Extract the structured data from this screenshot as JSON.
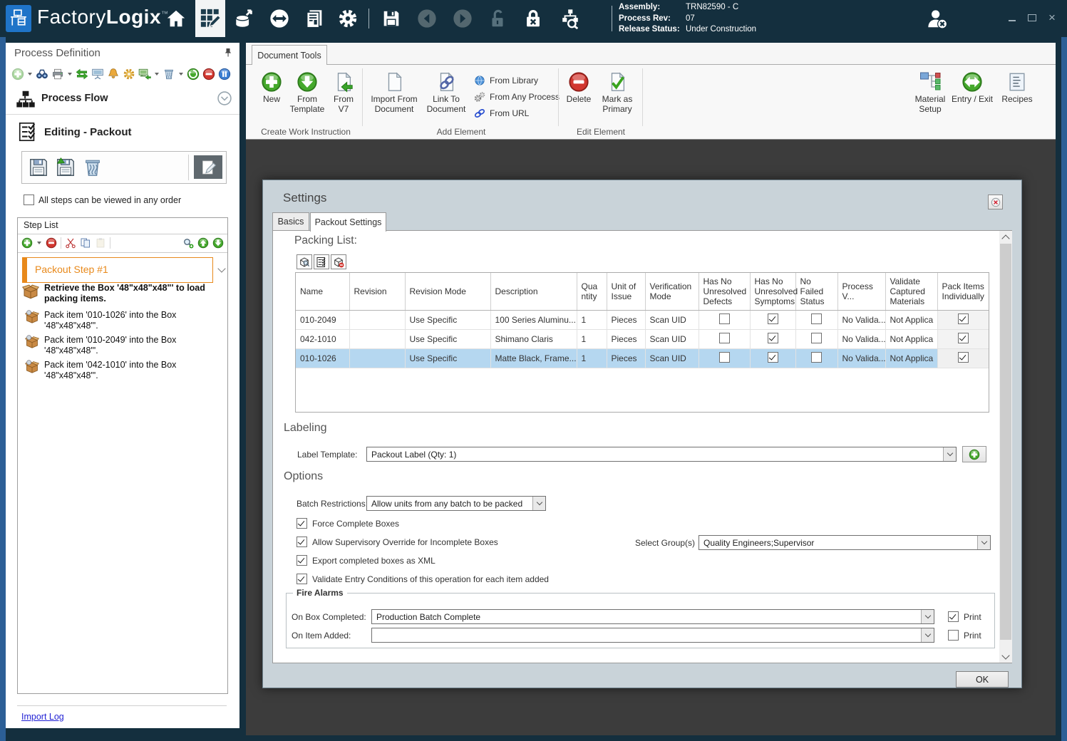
{
  "titlebar": {
    "app_name_light": "Factory",
    "app_name_bold": "Logix",
    "trademark": "™",
    "assembly": {
      "label": "Assembly:",
      "value": "TRN82590 - C"
    },
    "process_rev": {
      "label": "Process Rev:",
      "value": "07"
    },
    "release_status": {
      "label": "Release Status:",
      "value": "Under Construction"
    }
  },
  "left_panel": {
    "title": "Process Definition",
    "process_flow_label": "Process Flow",
    "editing_label": "Editing - Packout",
    "any_order": {
      "label": "All steps can be viewed in any order",
      "checked": false
    },
    "step_list": {
      "title": "Step List",
      "selected_step_label": "Packout Step #1",
      "steps": [
        {
          "text": "Retrieve the Box '48\"x48\"x48\"' to load packing items.",
          "bold": true
        },
        {
          "text": "Pack item '010-1026' into the Box '48\"x48\"x48\"'.",
          "bold": false
        },
        {
          "text": "Pack item '010-2049' into the Box '48\"x48\"x48\"'.",
          "bold": false
        },
        {
          "text": "Pack item '042-1010' into the Box '48\"x48\"x48\"'.",
          "bold": false
        }
      ]
    },
    "import_log": "Import Log"
  },
  "ribbon": {
    "tab_label": "Document Tools",
    "create_group": {
      "label": "Create Work Instruction",
      "new": "New",
      "from_template": "From Template",
      "from_v7": "From V7"
    },
    "add_group": {
      "label": "Add Element",
      "import_from_document": "Import From Document",
      "link_to_document": "Link To Document",
      "from_library": "From Library",
      "from_any_process": "From Any Process",
      "from_url": "From URL"
    },
    "edit_group": {
      "label": "Edit Element",
      "delete": "Delete",
      "mark_as_primary": "Mark as Primary"
    },
    "right_items": {
      "material_setup": "Material Setup",
      "entry_exit": "Entry / Exit",
      "recipes": "Recipes"
    }
  },
  "dialog": {
    "title": "Settings",
    "tab_basics": "Basics",
    "tab_packout": "Packout Settings",
    "packing_list": {
      "heading": "Packing List:",
      "columns": [
        "Name",
        "Revision",
        "Revision Mode",
        "Description",
        "Quantity",
        "Unit of Issue",
        "Verification Mode",
        "Has No Unresolved Defects",
        "Has No Unresolved Symptoms",
        "No Failed Status",
        "Process V...",
        "Validate Captured Materials",
        "Pack Items Individually"
      ],
      "rows": [
        {
          "name": "010-2049",
          "revision": "",
          "revision_mode": "Use Specific",
          "description": "100 Series Aluminu...",
          "quantity": "1",
          "unit_of_issue": "Pieces",
          "verification_mode": "Scan UID",
          "has_no_unresolved_defects": false,
          "has_no_unresolved_symptoms": true,
          "no_failed_status": false,
          "process_v": "No Valida...",
          "validate_captured_materials": "Not Applica",
          "pack_items_individually": true,
          "selected": false
        },
        {
          "name": "042-1010",
          "revision": "",
          "revision_mode": "Use Specific",
          "description": "Shimano Claris",
          "quantity": "1",
          "unit_of_issue": "Pieces",
          "verification_mode": "Scan UID",
          "has_no_unresolved_defects": false,
          "has_no_unresolved_symptoms": true,
          "no_failed_status": false,
          "process_v": "No Valida...",
          "validate_captured_materials": "Not Applica",
          "pack_items_individually": true,
          "selected": false
        },
        {
          "name": "010-1026",
          "revision": "",
          "revision_mode": "Use Specific",
          "description": "Matte Black, Frame...",
          "quantity": "1",
          "unit_of_issue": "Pieces",
          "verification_mode": "Scan UID",
          "has_no_unresolved_defects": false,
          "has_no_unresolved_symptoms": true,
          "no_failed_status": false,
          "process_v": "No Valida...",
          "validate_captured_materials": "Not Applica",
          "pack_items_individually": true,
          "selected": true
        }
      ]
    },
    "labeling": {
      "heading": "Labeling",
      "label_template_label": "Label Template:",
      "label_template_value": "Packout Label (Qty: 1)"
    },
    "options": {
      "heading": "Options",
      "batch_restrictions_label": "Batch Restrictions:",
      "batch_restrictions_value": "Allow units from any batch to be packed",
      "force_complete": {
        "label": "Force Complete Boxes",
        "checked": true
      },
      "supervisory_override": {
        "label": "Allow Supervisory Override for Incomplete Boxes",
        "checked": true
      },
      "export_xml": {
        "label": "Export completed boxes as XML",
        "checked": true
      },
      "validate_entry": {
        "label": "Validate Entry Conditions of this operation for each item added",
        "checked": true
      },
      "select_groups_label": "Select Group(s)",
      "select_groups_value": "Quality Engineers;Supervisor"
    },
    "fire_alarms": {
      "heading": "Fire Alarms",
      "on_box_completed_label": "On Box Completed:",
      "on_box_completed_value": "Production Batch Complete",
      "on_box_print": {
        "label": "Print",
        "checked": true
      },
      "on_item_added_label": "On Item Added:",
      "on_item_added_value": "",
      "on_item_print": {
        "label": "Print",
        "checked": false
      }
    },
    "ok_label": "OK"
  }
}
